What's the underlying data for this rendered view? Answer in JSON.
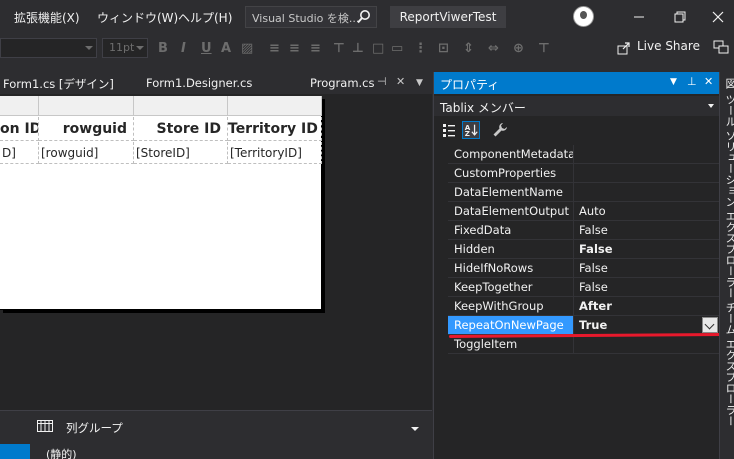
{
  "menubar": {
    "items": [
      "拡張機能(X)",
      "ウィンドウ(W)",
      "ヘルプ(H)"
    ],
    "search_placeholder": "Visual Studio を検...",
    "project_title": "ReportViwerTest"
  },
  "toolbar": {
    "font_size": "11pt",
    "live_share": "Live Share"
  },
  "doc_tabs": [
    "Form1.cs [デザイン]",
    "Form1.Designer.cs",
    "Program.cs"
  ],
  "report": {
    "headers": [
      "on ID",
      "rowguid",
      "Store ID",
      "Territory ID"
    ],
    "cells": [
      "D]",
      "[rowguid]",
      "[StoreID]",
      "[TerritoryID]"
    ]
  },
  "grouping": {
    "column_groups_label": "列グループ",
    "static_label": "(静的)"
  },
  "properties": {
    "title": "プロパティ",
    "object": "Tablix メンバー",
    "rows": [
      {
        "name": "ComponentMetadata",
        "value": "",
        "bold": false
      },
      {
        "name": "CustomProperties",
        "value": "",
        "bold": false
      },
      {
        "name": "DataElementName",
        "value": "",
        "bold": false
      },
      {
        "name": "DataElementOutput",
        "value": "Auto",
        "bold": false
      },
      {
        "name": "FixedData",
        "value": "False",
        "bold": false
      },
      {
        "name": "Hidden",
        "value": "False",
        "bold": true
      },
      {
        "name": "HideIfNoRows",
        "value": "False",
        "bold": false
      },
      {
        "name": "KeepTogether",
        "value": "False",
        "bold": false
      },
      {
        "name": "KeepWithGroup",
        "value": "After",
        "bold": true
      },
      {
        "name": "RepeatOnNewPage",
        "value": "True",
        "bold": true,
        "selected": true
      },
      {
        "name": "ToggleItem",
        "value": "",
        "bold": false
      }
    ]
  },
  "side_strip": [
    "図",
    "ツール",
    "ソリューション エクスプローラー",
    "チーム エクスプローラー"
  ],
  "colors": {
    "accent": "#007acc",
    "selection": "#3399ff",
    "annotation_red": "#e8192c",
    "background": "#2d2d30"
  }
}
